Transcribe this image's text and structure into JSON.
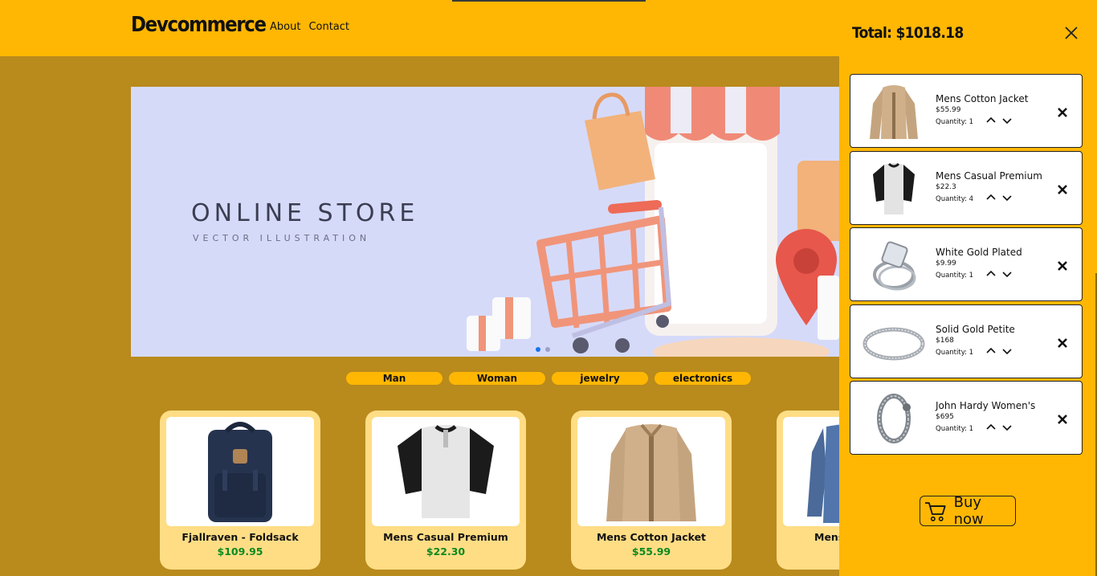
{
  "header": {
    "logo": "Devcommerce",
    "nav": [
      "About",
      "Contact"
    ]
  },
  "banner": {
    "title": "ONLINE STORE",
    "subtitle": "VECTOR ILLUSTRATION"
  },
  "categories": [
    "Man",
    "Woman",
    "jewelry",
    "electronics"
  ],
  "products": [
    {
      "name": "Fjallraven - Foldsack",
      "price": "$109.95",
      "icon": "backpack-image"
    },
    {
      "name": "Mens Casual Premium",
      "price": "$22.30",
      "icon": "raglan-tshirt-image"
    },
    {
      "name": "Mens Cotton Jacket",
      "price": "$55.99",
      "icon": "cotton-jacket-image"
    },
    {
      "name": "Mens",
      "price": "",
      "icon": "slim-shirt-image"
    }
  ],
  "cart": {
    "total": "Total: $1018.18",
    "items": [
      {
        "name": "Mens Cotton Jacket",
        "price": "$55.99",
        "quantity": "Quantity: 1"
      },
      {
        "name": "Mens Casual Premium",
        "price": "$22.3",
        "quantity": "Quantity: 4"
      },
      {
        "name": "White Gold Plated",
        "price": "$9.99",
        "quantity": "Quantity: 1"
      },
      {
        "name": "Solid Gold Petite",
        "price": "$168",
        "quantity": "Quantity: 1"
      },
      {
        "name": "John Hardy Women's",
        "price": "$695",
        "quantity": "Quantity: 1"
      }
    ],
    "buy_label": "Buy now"
  },
  "colors": {
    "header": "#ffb703",
    "page_bg": "#b98a1c",
    "card_bg": "#ffdd85",
    "price_green": "#0a8a1f",
    "banner_bg": "#d6daf9"
  }
}
